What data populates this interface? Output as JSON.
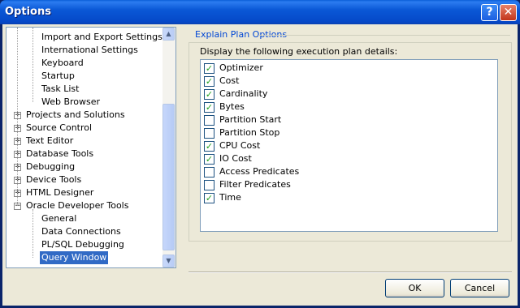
{
  "window": {
    "title": "Options",
    "help_glyph": "?",
    "close_glyph": "✕"
  },
  "tree": {
    "items": [
      {
        "label": "Import and Export Settings",
        "level": 2
      },
      {
        "label": "International Settings",
        "level": 2
      },
      {
        "label": "Keyboard",
        "level": 2
      },
      {
        "label": "Startup",
        "level": 2
      },
      {
        "label": "Task List",
        "level": 2
      },
      {
        "label": "Web Browser",
        "level": 2
      },
      {
        "label": "Projects and Solutions",
        "level": 1,
        "expander": "+"
      },
      {
        "label": "Source Control",
        "level": 1,
        "expander": "+"
      },
      {
        "label": "Text Editor",
        "level": 1,
        "expander": "+"
      },
      {
        "label": "Database Tools",
        "level": 1,
        "expander": "+"
      },
      {
        "label": "Debugging",
        "level": 1,
        "expander": "+"
      },
      {
        "label": "Device Tools",
        "level": 1,
        "expander": "+"
      },
      {
        "label": "HTML Designer",
        "level": 1,
        "expander": "+"
      },
      {
        "label": "Oracle Developer Tools",
        "level": 1,
        "expander": "−"
      },
      {
        "label": "General",
        "level": 2
      },
      {
        "label": "Data Connections",
        "level": 2
      },
      {
        "label": "PL/SQL Debugging",
        "level": 2
      },
      {
        "label": "Query Window",
        "level": 2,
        "selected": true
      }
    ],
    "scroll_up_glyph": "▲",
    "scroll_down_glyph": "▼"
  },
  "explain_plan": {
    "group_title": "Explain Plan Options",
    "description": "Display the following execution plan details:",
    "options": [
      {
        "label": "Optimizer",
        "checked": true
      },
      {
        "label": "Cost",
        "checked": true
      },
      {
        "label": "Cardinality",
        "checked": true
      },
      {
        "label": "Bytes",
        "checked": true
      },
      {
        "label": "Partition Start",
        "checked": false
      },
      {
        "label": "Partition Stop",
        "checked": false
      },
      {
        "label": "CPU Cost",
        "checked": true
      },
      {
        "label": "IO Cost",
        "checked": true
      },
      {
        "label": "Access Predicates",
        "checked": false
      },
      {
        "label": "Filter Predicates",
        "checked": false
      },
      {
        "label": "Time",
        "checked": true
      }
    ]
  },
  "buttons": {
    "ok": "OK",
    "cancel": "Cancel"
  }
}
